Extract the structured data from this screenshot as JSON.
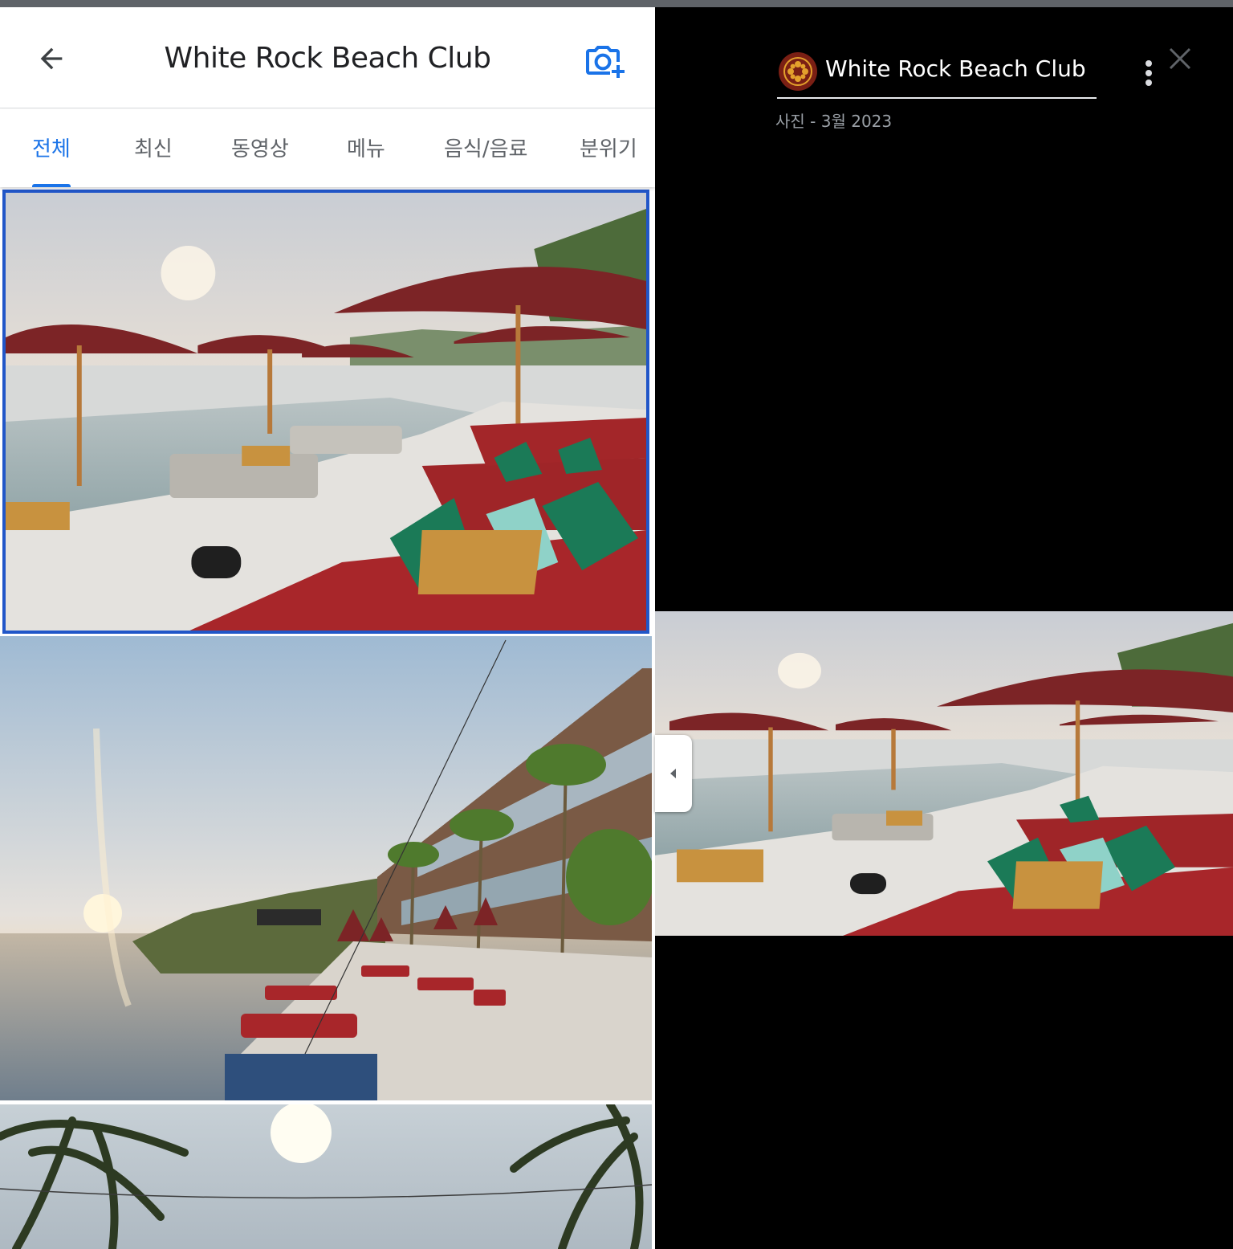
{
  "header": {
    "title": "White Rock Beach Club",
    "back_icon": "arrow-left-icon",
    "add_photo_icon": "camera-plus-icon"
  },
  "tabs": [
    {
      "label": "전체",
      "active": true
    },
    {
      "label": "최신",
      "active": false
    },
    {
      "label": "동영상",
      "active": false
    },
    {
      "label": "메뉴",
      "active": false
    },
    {
      "label": "음식/음료",
      "active": false
    },
    {
      "label": "분위기",
      "active": false
    }
  ],
  "gallery": {
    "photos": [
      {
        "subject": "poolside cabanas with maroon umbrellas at sunset",
        "selected": true
      },
      {
        "subject": "infinity pool and sun loungers along building at sunset",
        "selected": false
      },
      {
        "subject": "palm trees against the sun",
        "selected": false
      }
    ]
  },
  "viewer": {
    "place_name": "White Rock Beach Club",
    "photo_meta": "사진 - 3월 2023",
    "more_icon": "more-vertical-icon",
    "close_icon": "close-icon",
    "collapse_icon": "chevron-left-icon"
  },
  "colors": {
    "accent": "#1a73e8",
    "selection_border": "#2156c8",
    "viewer_bg": "#000000",
    "umbrella": "#7c2426",
    "cushion": "#a8262a",
    "pillow": "#1b7a57"
  }
}
